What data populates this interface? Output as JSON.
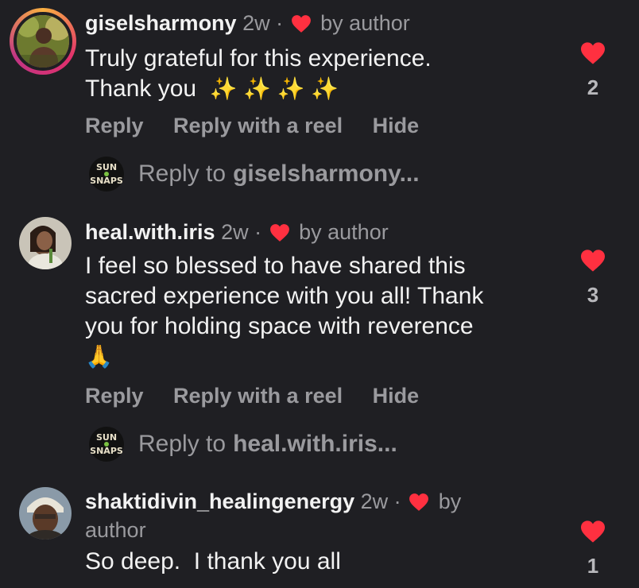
{
  "comments": [
    {
      "username": "giselsharmony",
      "time": "2w",
      "separator": "·",
      "liked_label": "by author",
      "text_line1": "Truly grateful for this experience.",
      "text_line2": "Thank you",
      "emoji": "✨ ✨ ✨ ✨",
      "likes": "2",
      "actions": {
        "reply": "Reply",
        "reply_reel": "Reply with a reel",
        "hide": "Hide"
      },
      "reply_prompt": {
        "prefix": "Reply to",
        "user": "giselsharmony..."
      }
    },
    {
      "username": "heal.with.iris",
      "time": "2w",
      "separator": "·",
      "liked_label": "by author",
      "text_line1": "I feel so blessed to have shared this",
      "text_line2": "sacred experience with you all! Thank",
      "text_line3": "you for holding space with reverence",
      "emoji": "🙏",
      "likes": "3",
      "actions": {
        "reply": "Reply",
        "reply_reel": "Reply with a reel",
        "hide": "Hide"
      },
      "reply_prompt": {
        "prefix": "Reply to",
        "user": "heal.with.iris..."
      }
    },
    {
      "username": "shaktidivin_healingenergy",
      "time": "2w",
      "separator": "·",
      "liked_label_part1": "by",
      "liked_label_part2": "author",
      "text_line1": "So deep.  I thank you all",
      "likes": "1"
    }
  ],
  "badge": {
    "line1": "SUN",
    "line2": "SNAPS"
  },
  "colors": {
    "background": "#1f1f23",
    "heart": "#ff3040",
    "muted": "#9a9a9e",
    "text": "#f2f2f2"
  },
  "icons": {
    "like": "heart-icon",
    "liked_by_author": "heart-icon"
  }
}
